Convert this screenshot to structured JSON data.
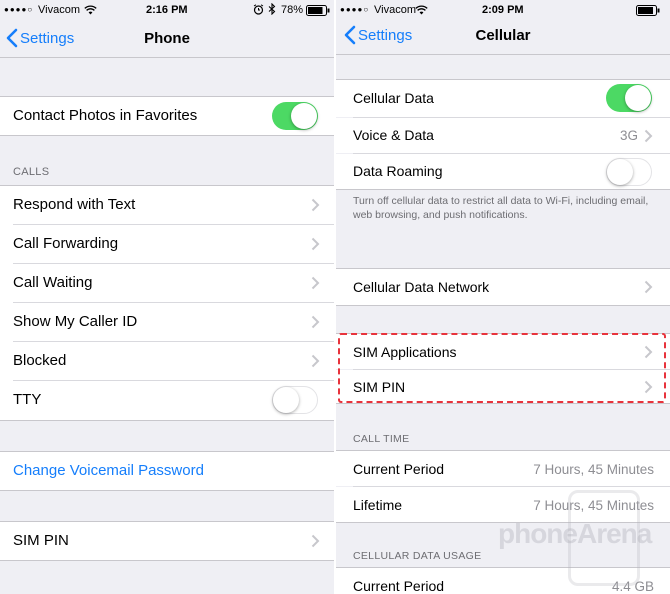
{
  "left": {
    "status": {
      "carrier": "Vivacom",
      "time": "2:16 PM",
      "battery": "78%"
    },
    "nav": {
      "back": "Settings",
      "title": "Phone"
    },
    "rows": {
      "contact_photos": "Contact Photos in Favorites",
      "calls_header": "CALLS",
      "respond": "Respond with Text",
      "forwarding": "Call Forwarding",
      "waiting": "Call Waiting",
      "caller_id": "Show My Caller ID",
      "blocked": "Blocked",
      "tty": "TTY",
      "voicemail": "Change Voicemail Password",
      "sim_pin": "SIM PIN"
    },
    "toggles": {
      "contact_photos": "on",
      "tty": "off"
    }
  },
  "right": {
    "status": {
      "carrier": "Vivacom",
      "time": "2:09 PM"
    },
    "nav": {
      "back": "Settings",
      "title": "Cellular"
    },
    "rows": {
      "cellular_data": "Cellular Data",
      "voice_data": "Voice & Data",
      "voice_data_value": "3G",
      "roaming": "Data Roaming",
      "footer": "Turn off cellular data to restrict all data to Wi-Fi, including email, web browsing, and push notifications.",
      "data_network": "Cellular Data Network",
      "sim_apps": "SIM Applications",
      "sim_pin": "SIM PIN",
      "call_time_header": "CALL TIME",
      "current_period": "Current Period",
      "current_period_value": "7 Hours, 45 Minutes",
      "lifetime": "Lifetime",
      "lifetime_value": "7 Hours, 45 Minutes",
      "usage_header": "CELLULAR DATA USAGE",
      "usage_current": "Current Period",
      "usage_current_value": "4.4 GB"
    },
    "toggles": {
      "cellular_data": "on",
      "roaming": "off"
    }
  },
  "watermark": "phoneArena",
  "colors": {
    "accent": "#157efb",
    "toggle_on": "#4cd964",
    "highlight": "#e8333c",
    "background": "#efeff4"
  }
}
